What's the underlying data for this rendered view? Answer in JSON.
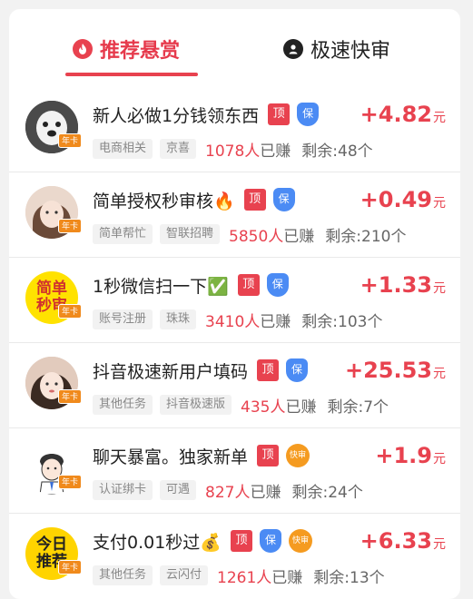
{
  "tabs": [
    {
      "label": "推荐悬赏",
      "icon": "fire-icon"
    },
    {
      "label": "极速快审",
      "icon": "user-icon"
    }
  ],
  "colors": {
    "accent": "#e8424f",
    "bao": "#4b8bf4",
    "kuai": "#f59b20"
  },
  "tasks": [
    {
      "title": "新人必做1分钱领东西",
      "tags": [
        "顶",
        "保"
      ],
      "categories": [
        "电商相关",
        "京喜"
      ],
      "earned_count": "1078人",
      "earned_label": "已赚",
      "remaining": "剩余:48个",
      "reward": "+4.82",
      "unit": "元",
      "avatar_badge": "年卡",
      "avatar_text": ""
    },
    {
      "title": "简单授权秒审核🔥",
      "tags": [
        "顶",
        "保"
      ],
      "categories": [
        "简单帮忙",
        "智联招聘"
      ],
      "earned_count": "5850人",
      "earned_label": "已赚",
      "remaining": "剩余:210个",
      "reward": "+0.49",
      "unit": "元",
      "avatar_badge": "年卡",
      "avatar_text": ""
    },
    {
      "title": "1秒微信扫一下✅",
      "tags": [
        "顶",
        "保"
      ],
      "categories": [
        "账号注册",
        "珠珠"
      ],
      "earned_count": "3410人",
      "earned_label": "已赚",
      "remaining": "剩余:103个",
      "reward": "+1.33",
      "unit": "元",
      "avatar_badge": "年卡",
      "avatar_text": "简单\n秒审"
    },
    {
      "title": "抖音极速新用户填码",
      "tags": [
        "顶",
        "保"
      ],
      "categories": [
        "其他任务",
        "抖音极速版"
      ],
      "earned_count": "435人",
      "earned_label": "已赚",
      "remaining": "剩余:7个",
      "reward": "+25.53",
      "unit": "元",
      "avatar_badge": "年卡",
      "avatar_text": ""
    },
    {
      "title": "聊天暴富。独家新单",
      "tags": [
        "顶",
        "快审"
      ],
      "categories": [
        "认证绑卡",
        "可遇"
      ],
      "earned_count": "827人",
      "earned_label": "已赚",
      "remaining": "剩余:24个",
      "reward": "+1.9",
      "unit": "元",
      "avatar_badge": "年卡",
      "avatar_text": ""
    },
    {
      "title": "支付0.01秒过💰",
      "tags": [
        "顶",
        "保",
        "快审"
      ],
      "categories": [
        "其他任务",
        "云闪付"
      ],
      "earned_count": "1261人",
      "earned_label": "已赚",
      "remaining": "剩余:13个",
      "reward": "+6.33",
      "unit": "元",
      "avatar_badge": "年卡",
      "avatar_text": "今日\n推荐"
    }
  ]
}
